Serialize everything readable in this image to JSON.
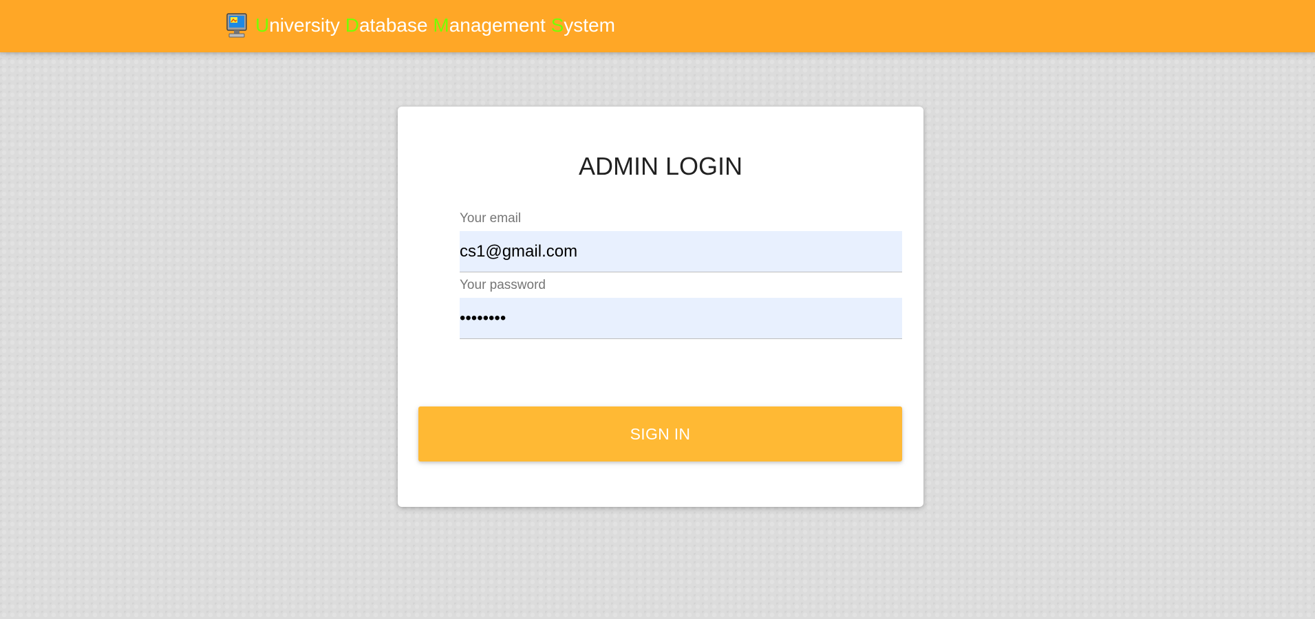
{
  "header": {
    "logo_icon": "computer-monitor-icon",
    "brand_parts": [
      {
        "initial": "U",
        "rest": "niversity "
      },
      {
        "initial": "D",
        "rest": "atabase "
      },
      {
        "initial": "M",
        "rest": "anagement "
      },
      {
        "initial": "S",
        "rest": "ystem"
      }
    ]
  },
  "login": {
    "title": "ADMIN LOGIN",
    "email_label": "Your email",
    "email_value": "cs1@gmail.com",
    "password_label": "Your password",
    "password_value": "••••••••",
    "signin_label": "SIGN IN"
  },
  "colors": {
    "navbar": "#ffa726",
    "brand_highlight": "#76ff03",
    "button": "#ffb934",
    "input_background": "#e8f0fe",
    "page_background": "#dcdcdc"
  }
}
